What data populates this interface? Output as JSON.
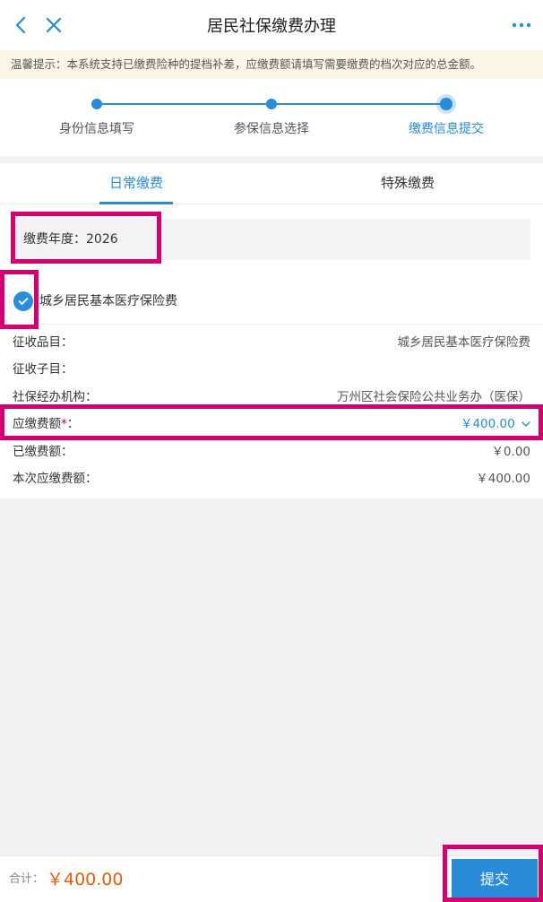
{
  "header": {
    "title": "居民社保缴费办理"
  },
  "notice": {
    "text": "温馨提示：本系统支持已缴费险种的提档补差，应缴费额请填写需要缴费的档次对应的总金额。"
  },
  "steps": [
    {
      "label": "身份信息填写",
      "active": false
    },
    {
      "label": "参保信息选择",
      "active": false
    },
    {
      "label": "缴费信息提交",
      "active": true
    }
  ],
  "tabs": [
    {
      "label": "日常缴费",
      "active": true
    },
    {
      "label": "特殊缴费",
      "active": false
    }
  ],
  "form": {
    "year_label": "缴费年度：2026",
    "insurance_name": "城乡居民基本医疗保险费",
    "fields": {
      "item_key": "征收品目：",
      "item_value": "城乡居民基本医疗保险费",
      "subitem_key": "征收子目：",
      "subitem_value": "",
      "agency_key": "社保经办机构：",
      "agency_value": "万州区社会保险公共业务办（医保）",
      "amount_key": "应缴费额",
      "amount_required": "*",
      "amount_colon": "：",
      "amount_value": "￥400.00",
      "paid_key": "已缴费额：",
      "paid_value": "￥0.00",
      "current_key": "本次应缴费额：",
      "current_value": "￥400.00"
    }
  },
  "footer": {
    "total_label": "合计：",
    "total_value": "￥400.00",
    "submit_label": "提交"
  },
  "colors": {
    "accent": "#2a8bd8",
    "highlight": "#d4006f",
    "total": "#e35d0f"
  }
}
